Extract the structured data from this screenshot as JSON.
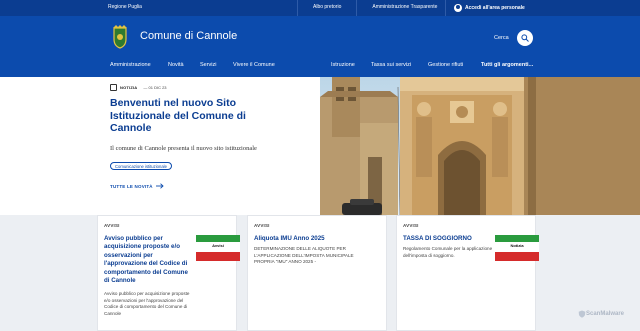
{
  "topbar": {
    "region": "Regione Puglia",
    "links": [
      "Albo pretorio",
      "Amministrazione Trasparente"
    ],
    "login": "Accedi all'area personale"
  },
  "header": {
    "site_name": "Comune di Cannole",
    "search_label": "Cerca"
  },
  "nav": {
    "items": [
      "Amministrazione",
      "Novità",
      "Servizi",
      "Vivere il Comune"
    ],
    "secondary": [
      "Istruzione",
      "Tassa sui servizi",
      "Gestione rifiuti",
      "Tutti gli argomenti..."
    ]
  },
  "hero": {
    "tag": "NOTIZIA",
    "date": "— 01 DIC 23",
    "title": "Benvenuti nel nuovo Sito Istituzionale del Comune di Cannole",
    "description": "Il comune di Cannole presenta il nuovo sito istituzionale",
    "chip": "Comunicazione istituzionale",
    "all_news": "TUTTE LE NOVITÀ"
  },
  "cards": [
    {
      "tag": "AVVISI",
      "title": "Avviso pubblico per acquisizione proposte e/o osservazioni per l'approvazione del Codice di comportamento del Comune di Cannole",
      "text": "Avviso pubblico per acquisizione proposte e/o osservazioni per l'approvazione del Codice di comportamento del Comune di Cannole",
      "flag_text": "Avvisi"
    },
    {
      "tag": "AVVISI",
      "title": "Aliquota IMU Anno 2025",
      "text": "DETERMINAZIONE DELLE ALIQUOTE PER L'APPLICAZIONE DELL'IMPOSTA MUNICIPALE PROPRIA \"IMU\" ANNO 2025 -"
    },
    {
      "tag": "AVVISI",
      "title": "TASSA DI SOGGIORNO",
      "text": "Regolamento Comunale per la applicazione dell'imposta di soggiorno.",
      "flag_text": "Notizia"
    }
  ],
  "watermark": "ScanMalware",
  "colors": {
    "topbar": "#0b3d91",
    "header": "#0c4bad",
    "accent": "#0b3d91",
    "flag_green": "#2a9b3e",
    "flag_red": "#d52b2b"
  }
}
